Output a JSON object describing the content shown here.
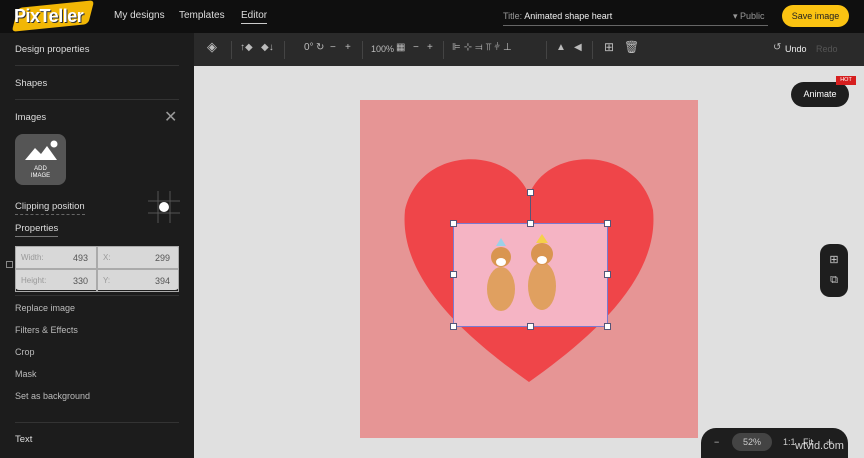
{
  "header": {
    "logo": "PixTeller",
    "nav": [
      "My designs",
      "Templates",
      "Editor"
    ],
    "title_label": "Title:",
    "title_value": "Animated shape heart",
    "visibility": "▾ Public",
    "save": "Save image"
  },
  "sidebar": {
    "design_properties": "Design properties",
    "shapes": "Shapes",
    "images": "Images",
    "add_image": "ADD IMAGE",
    "clipping": "Clipping position",
    "properties": "Properties",
    "fields": {
      "width_label": "Width:",
      "width": "493",
      "x_label": "X:",
      "x": "299",
      "height_label": "Height:",
      "height": "330",
      "y_label": "Y:",
      "y": "394"
    },
    "options": [
      "Replace image",
      "Filters & Effects",
      "Crop",
      "Mask",
      "Set as background"
    ],
    "text": "Text"
  },
  "toolbar": {
    "rotation": "0°",
    "zoom": "100%",
    "undo": "Undo",
    "redo": "Redo"
  },
  "canvas": {
    "animate": "Animate",
    "hot": "HOT",
    "bg_color": "#e69595",
    "heart_color": "#ef4549"
  },
  "zoombar": {
    "minus": "−",
    "value": "52%",
    "one": "1:1",
    "fit": "Fit",
    "plus": "+"
  },
  "watermark": "wtvid.com"
}
